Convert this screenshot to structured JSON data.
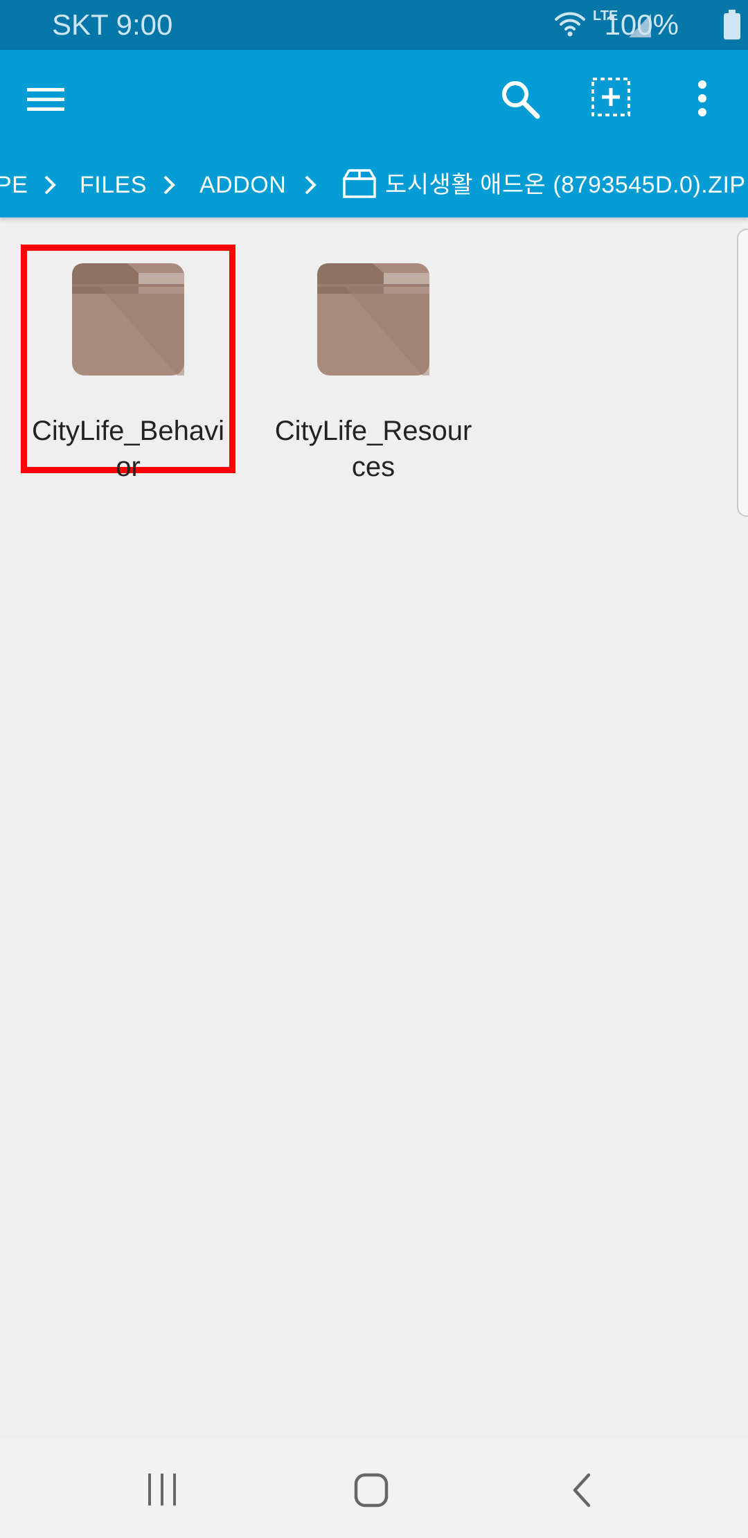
{
  "status_bar": {
    "carrier_time": "SKT 9:00",
    "network": "LTE",
    "battery": "100%",
    "icons": [
      "wifi-icon",
      "lte-icon",
      "signal-icon",
      "battery-icon"
    ]
  },
  "toolbar": {
    "icons": [
      "menu-icon",
      "search-icon",
      "select-icon",
      "more-options-icon"
    ]
  },
  "breadcrumb": {
    "items": [
      "PE",
      "FILES",
      "ADDON",
      "도시생활 애드온 (8793545D.0).ZIP"
    ],
    "archive_icon": "archive-icon"
  },
  "folders": [
    {
      "name": "CityLife_Behavior",
      "selected": true
    },
    {
      "name": "CityLife_Resources",
      "selected": false
    }
  ],
  "nav_bar": {
    "icons": [
      "recent-apps-icon",
      "home-icon",
      "back-icon"
    ]
  },
  "colors": {
    "status_bar": "#0277a8",
    "app_bar": "#039cd4",
    "background": "#efefef",
    "folder_body": "#a88b7c",
    "folder_tab": "#8e7264",
    "selection": "#ff0000"
  }
}
